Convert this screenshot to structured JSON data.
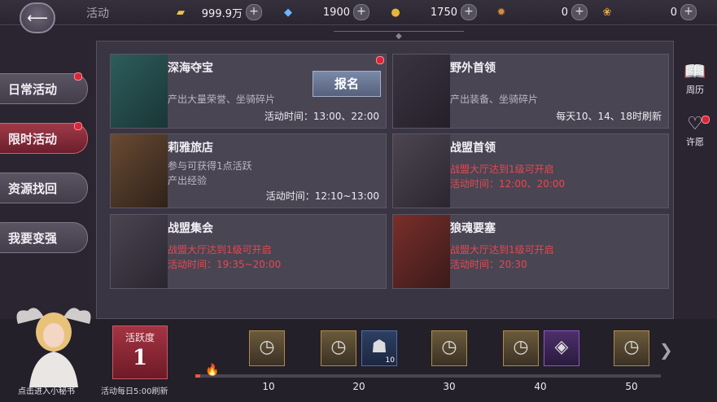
{
  "header": {
    "title": "活动"
  },
  "resources": [
    {
      "icon": "gold-bar-icon",
      "value": "999.9万",
      "color": "#f0c24a"
    },
    {
      "icon": "diamond-icon",
      "value": "1900",
      "color": "#6fb4ff"
    },
    {
      "icon": "coin-icon",
      "value": "1750",
      "color": "#e8b33a"
    },
    {
      "icon": "medal-icon",
      "value": "0",
      "color": "#d98b3b"
    },
    {
      "icon": "feather-icon",
      "value": "0",
      "color": "#e2a748"
    }
  ],
  "nav": [
    {
      "label": "日常活动",
      "active": false,
      "dot": true
    },
    {
      "label": "限时活动",
      "active": true,
      "dot": true
    },
    {
      "label": "资源找回",
      "active": false,
      "dot": false
    },
    {
      "label": "我要变强",
      "active": false,
      "dot": false
    }
  ],
  "cards": [
    {
      "title": "深海夺宝",
      "lines": [
        "产出大量荣誉、坐骑碎片"
      ],
      "time": "活动时间：13:00、22:00",
      "button": "报名",
      "red": false,
      "art": "deep-sea-treasure-art"
    },
    {
      "title": "野外首领",
      "lines": [
        "产出装备、坐骑碎片"
      ],
      "time": "每天10、14、18时刷新",
      "red": false,
      "art": "wild-boss-art"
    },
    {
      "title": "莉雅旅店",
      "lines": [
        "参与可获得1点活跃",
        "产出经验"
      ],
      "time": "活动时间：12:10~13:00",
      "red": false,
      "art": "lia-inn-art"
    },
    {
      "title": "战盟首领",
      "lines": [
        "战盟大厅达到1级可开启",
        "活动时间：12:00、20:00"
      ],
      "time": "",
      "red": true,
      "art": "guild-boss-art"
    },
    {
      "title": "战盟集会",
      "lines": [
        "战盟大厅达到1级可开启",
        "活动时间：19:35~20:00"
      ],
      "time": "",
      "red": true,
      "art": "guild-gathering-art"
    },
    {
      "title": "狼魂要塞",
      "lines": [
        "战盟大厅达到1级可开启",
        "活动时间：20:30"
      ],
      "time": "",
      "red": true,
      "art": "wolf-soul-fortress-art"
    }
  ],
  "side_buttons": [
    {
      "label": "周历",
      "icon": "book-icon"
    },
    {
      "label": "许愿",
      "icon": "wish-heart-icon"
    }
  ],
  "secretary": {
    "label": "点击进入小秘书"
  },
  "activity": {
    "label": "活跃度",
    "value": "1",
    "refresh": "活动每日5:00刷新",
    "progress": 0.01
  },
  "milestones": [
    "10",
    "20",
    "30",
    "40",
    "50"
  ],
  "rewards": [
    {
      "icon": "pocket-watch-icon"
    },
    {
      "icon": "pocket-watch-icon"
    },
    {
      "icon": "silver-chest-icon",
      "qty": "10"
    },
    {
      "icon": "pocket-watch-icon"
    },
    {
      "icon": "pocket-watch-icon"
    },
    {
      "icon": "crystal-gem-icon"
    },
    {
      "icon": "pocket-watch-icon"
    }
  ]
}
